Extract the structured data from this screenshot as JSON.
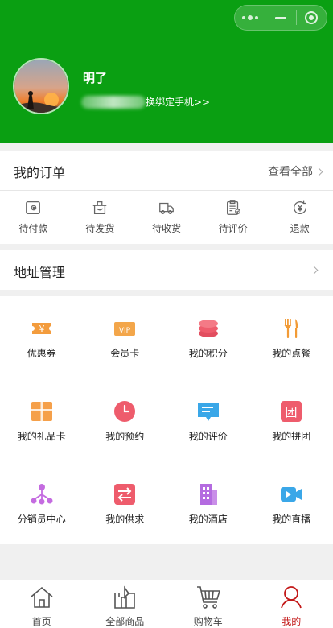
{
  "header": {
    "username": "明了",
    "bind_phone_link": "换绑定手机>>"
  },
  "orders": {
    "title": "我的订单",
    "view_all": "查看全部",
    "items": [
      {
        "label": "待付款",
        "icon": "wallet-icon"
      },
      {
        "label": "待发货",
        "icon": "package-icon"
      },
      {
        "label": "待收货",
        "icon": "truck-icon"
      },
      {
        "label": "待评价",
        "icon": "review-clipboard-icon"
      },
      {
        "label": "退款",
        "icon": "refund-yen-icon"
      }
    ]
  },
  "address": {
    "title": "地址管理"
  },
  "services": [
    {
      "label": "优惠券",
      "icon": "coupon-icon",
      "color": "#f39c3d"
    },
    {
      "label": "会员卡",
      "icon": "vip-card-icon",
      "color": "#f3a64a"
    },
    {
      "label": "我的积分",
      "icon": "points-stack-icon",
      "color": "#ee5c6c"
    },
    {
      "label": "我的点餐",
      "icon": "fork-knife-icon",
      "color": "#f29b36"
    },
    {
      "label": "我的礼品卡",
      "icon": "gift-card-icon",
      "color": "#f5a04a"
    },
    {
      "label": "我的预约",
      "icon": "clock-icon",
      "color": "#ee5c6c"
    },
    {
      "label": "我的评价",
      "icon": "comment-icon",
      "color": "#3aa7e8"
    },
    {
      "label": "我的拼团",
      "icon": "group-buy-icon",
      "color": "#ee5c6c"
    },
    {
      "label": "分销员中心",
      "icon": "distribution-network-icon",
      "color": "#c46be0"
    },
    {
      "label": "我的供求",
      "icon": "exchange-icon",
      "color": "#ee5c6c"
    },
    {
      "label": "我的酒店",
      "icon": "hotel-building-icon",
      "color": "#b46be0"
    },
    {
      "label": "我的直播",
      "icon": "video-camera-icon",
      "color": "#3aa7e8"
    }
  ],
  "tabbar": [
    {
      "label": "首页",
      "icon": "home-icon",
      "active": false
    },
    {
      "label": "全部商品",
      "icon": "shop-bag-icon",
      "active": false
    },
    {
      "label": "购物车",
      "icon": "cart-icon",
      "active": false
    },
    {
      "label": "我的",
      "icon": "user-icon",
      "active": true
    }
  ],
  "colors": {
    "brand_green": "#0a9f12",
    "active_red": "#c31818"
  }
}
